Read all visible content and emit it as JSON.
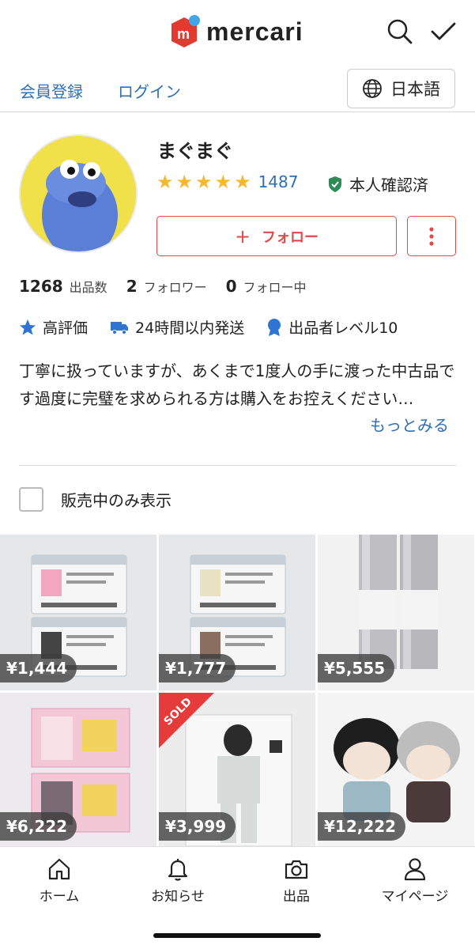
{
  "header": {
    "logo_text": "mercari",
    "logo_color": "#e23a2e",
    "accent_dot": "#3fa7e9",
    "icons": [
      "search-icon",
      "checkmark-icon"
    ]
  },
  "auth": {
    "register": "会員登録",
    "login": "ログイン",
    "language": "日本語"
  },
  "profile": {
    "name": "まぐまぐ",
    "rating_stars": 5,
    "rating_count": "1487",
    "verified_label": "本人確認済",
    "follow_label": "フォロー",
    "stats": [
      {
        "num": "1268",
        "label": "出品数"
      },
      {
        "num": "2",
        "label": "フォロワー"
      },
      {
        "num": "0",
        "label": "フォロー中"
      }
    ],
    "badges": [
      "高評価",
      "24時間以内発送",
      "出品者レベル10"
    ],
    "description": "丁寧に扱っていますが、あくまで1度人の手に渡った中古品です過度に完璧を求められる方は購入をお控えください…",
    "more_link": "もっとみる"
  },
  "filter": {
    "label": "販売中のみ表示",
    "checked": false
  },
  "items": [
    {
      "price": "¥1,444",
      "sold": false
    },
    {
      "price": "¥1,777",
      "sold": false
    },
    {
      "price": "¥5,555",
      "sold": false
    },
    {
      "price": "¥6,222",
      "sold": false
    },
    {
      "price": "¥3,999",
      "sold": true,
      "sold_label": "SOLD"
    },
    {
      "price": "¥12,222",
      "sold": false
    }
  ],
  "tabbar": [
    {
      "label": "ホーム",
      "icon": "home-icon"
    },
    {
      "label": "お知らせ",
      "icon": "bell-icon"
    },
    {
      "label": "出品",
      "icon": "camera-icon"
    },
    {
      "label": "マイページ",
      "icon": "person-icon"
    }
  ]
}
